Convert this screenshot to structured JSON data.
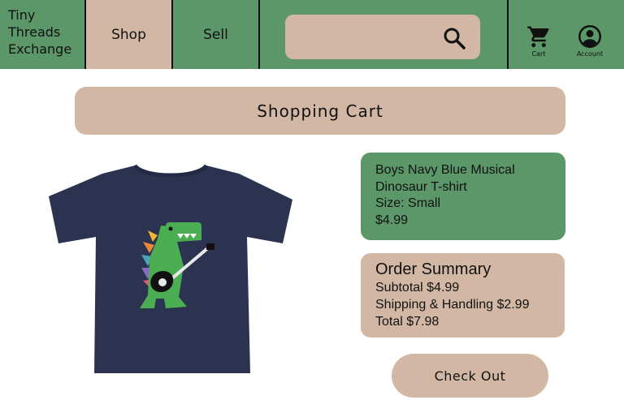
{
  "brand": {
    "line1": "Tiny",
    "line2": "Threads",
    "line3": "Exchange"
  },
  "nav": {
    "shop_label": "Shop",
    "sell_label": "Sell",
    "search": {
      "value": "",
      "icon": "search-icon"
    },
    "cart_label": "Cart",
    "account_label": "Account"
  },
  "page": {
    "title": "Shopping Cart",
    "item": {
      "name_line1": "Boys Navy Blue Musical",
      "name_line2": "Dinosaur T-shirt",
      "size": "Size: Small",
      "price": "$4.99",
      "image": "navy-dinosaur-guitar-tshirt"
    },
    "summary": {
      "title": "Order Summary",
      "subtotal": "Subtotal $4.99",
      "shipping": "Shipping & Handling $2.99",
      "total": "Total $7.98"
    },
    "checkout_label": "Check Out"
  },
  "colors": {
    "green": "#5b9768",
    "tan": "#d2b8a4",
    "navy": "#2b3350"
  }
}
